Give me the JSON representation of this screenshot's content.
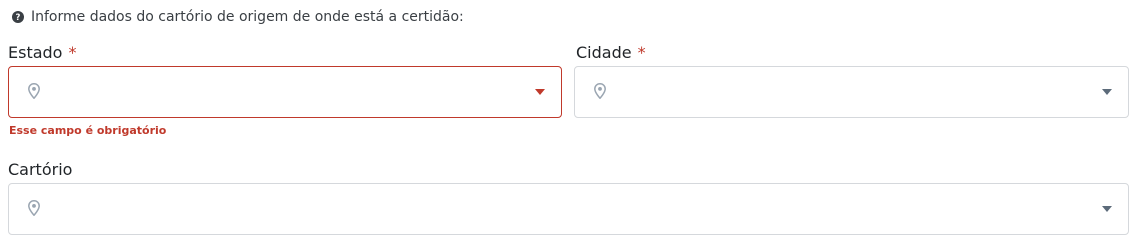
{
  "info": {
    "icon": "question-circle-icon",
    "text": "Informe dados do cartório de origem de onde está a certidão:"
  },
  "fields": {
    "estado": {
      "label": "Estado",
      "required_mark": "*",
      "value": "",
      "icon": "map-pin-icon",
      "error": "Esse campo é obrigatório",
      "caret_color": "#c0392b",
      "border_color": "#c0392b"
    },
    "cidade": {
      "label": "Cidade",
      "required_mark": "*",
      "value": "",
      "icon": "map-pin-icon",
      "caret_color": "#5c6b7a"
    },
    "cartorio": {
      "label": "Cartório",
      "value": "",
      "icon": "map-pin-icon",
      "caret_color": "#5c6b7a"
    }
  },
  "colors": {
    "error": "#c0392b",
    "border": "#d5d8dc",
    "icon": "#9aa5b1"
  }
}
